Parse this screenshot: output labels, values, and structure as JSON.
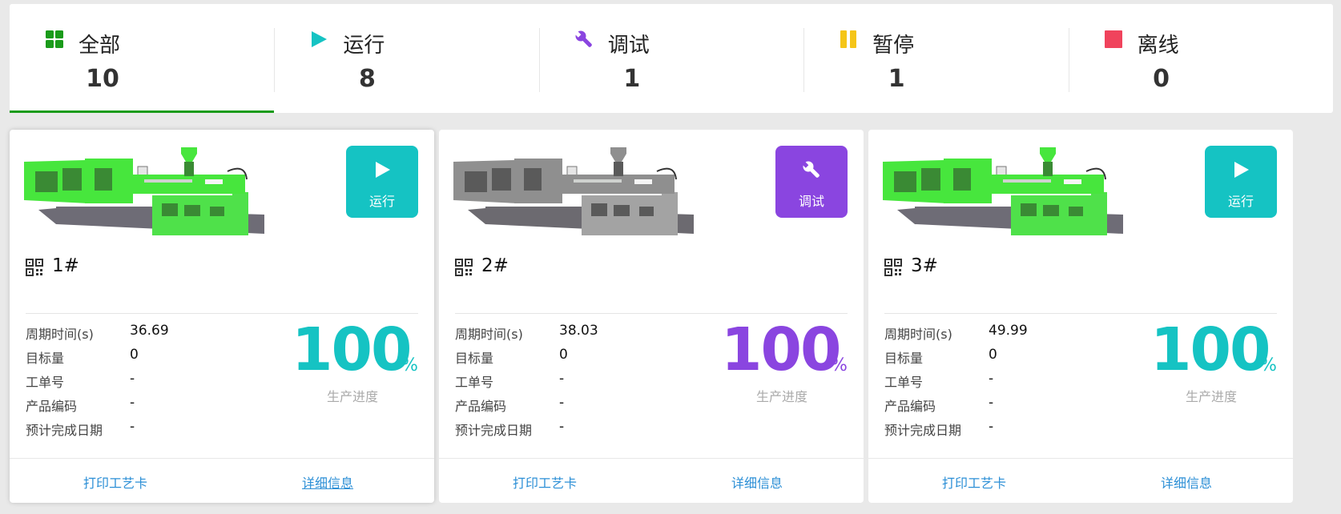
{
  "colors": {
    "green": "#1a9b1a",
    "teal": "#15c3c3",
    "purple": "#8a45e0",
    "yellow": "#f5c518",
    "red": "#f0435c",
    "link": "#2c8fd6"
  },
  "summary": [
    {
      "icon": "grid-icon",
      "label": "全部",
      "count": "10"
    },
    {
      "icon": "play-icon",
      "label": "运行",
      "count": "8"
    },
    {
      "icon": "wrench-icon",
      "label": "调试",
      "count": "1"
    },
    {
      "icon": "pause-icon",
      "label": "暂停",
      "count": "1"
    },
    {
      "icon": "stop-square-icon",
      "label": "离线",
      "count": "0"
    }
  ],
  "field_labels": {
    "cycle": "周期时间(s)",
    "target": "目标量",
    "work_order": "工单号",
    "product_code": "产品编码",
    "due_date": "预计完成日期",
    "progress_caption": "生产进度",
    "percent_unit": "%",
    "print_card": "打印工艺卡",
    "details": "详细信息"
  },
  "machines": [
    {
      "name": "1#",
      "status": "运行",
      "status_icon": "play-icon",
      "cycle_time": "36.69",
      "target": "0",
      "work_order": "-",
      "product_code": "-",
      "due_date": "-",
      "progress": "100",
      "progress_value": 100
    },
    {
      "name": "2#",
      "status": "调试",
      "status_icon": "wrench-icon",
      "cycle_time": "38.03",
      "target": "0",
      "work_order": "-",
      "product_code": "-",
      "due_date": "-",
      "progress": "100",
      "progress_value": 100
    },
    {
      "name": "3#",
      "status": "运行",
      "status_icon": "play-icon",
      "cycle_time": "49.99",
      "target": "0",
      "work_order": "-",
      "product_code": "-",
      "due_date": "-",
      "progress": "100",
      "progress_value": 100
    }
  ]
}
